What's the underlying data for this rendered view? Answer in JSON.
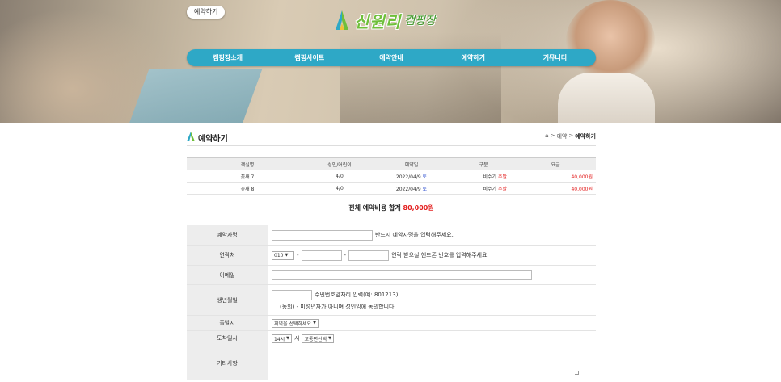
{
  "header": {
    "reserve_button": "예약하기",
    "logo_main": "신원리",
    "logo_sub": "캠핑장",
    "nav": [
      "캠핑장소개",
      "캠핑사이트",
      "예약안내",
      "예약하기",
      "커뮤니티"
    ]
  },
  "page": {
    "title": "예약하기",
    "breadcrumb": {
      "home_icon": "home-icon",
      "sep": ">",
      "level1": "예약",
      "current": "예약하기"
    }
  },
  "rooms_table": {
    "headers": [
      "객실명",
      "성인/어린이",
      "예약일",
      "구분",
      "요금"
    ],
    "rows": [
      {
        "name": "꽃새 7",
        "guests": "4/0",
        "date": "2022/04/9",
        "day": "토",
        "season": "비수기",
        "daytype": "주말",
        "price": "40,000원"
      },
      {
        "name": "꽃새 8",
        "guests": "4/0",
        "date": "2022/04/9",
        "day": "토",
        "season": "비수기",
        "daytype": "주말",
        "price": "40,000원"
      }
    ]
  },
  "total": {
    "label": "전체 예약비용 합계",
    "amount": "80,000원"
  },
  "form": {
    "name": {
      "label": "예약자명",
      "hint": "반드시 예약자명을 입력해주세요."
    },
    "phone": {
      "label": "연락처",
      "prefix": "010",
      "dash": "-",
      "hint": "연락 받으실 핸드폰 번호를 입력해주세요."
    },
    "email": {
      "label": "이메일"
    },
    "birth": {
      "label": "생년월일",
      "hint": "주민번호앞자리 입력(예: 801213)",
      "consent": "(동의) - 미성년자가 아니며 성인임에 동의합니다."
    },
    "departure": {
      "label": "출발지",
      "select": "지역을 선택하세요"
    },
    "arrival": {
      "label": "도착일시",
      "hour": "14시",
      "hour_suffix": "시",
      "transport": "교통편선택"
    },
    "etc": {
      "label": "기타사항"
    }
  },
  "colors": {
    "nav_bg": "#2ea8c6",
    "accent_red": "#e31e1e",
    "weekend_blue": "#2244cc",
    "logo_green": "#6fbf3a"
  }
}
